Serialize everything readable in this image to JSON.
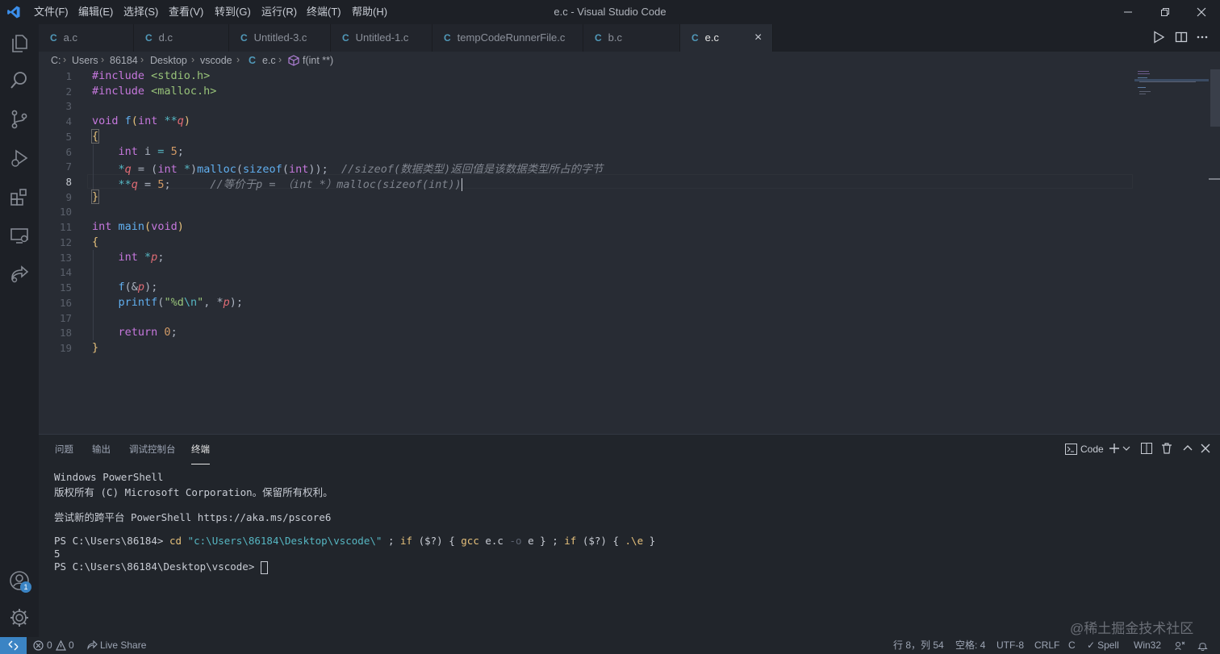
{
  "window": {
    "title": "e.c - Visual Studio Code"
  },
  "menu": [
    "文件(F)",
    "编辑(E)",
    "选择(S)",
    "查看(V)",
    "转到(G)",
    "运行(R)",
    "终端(T)",
    "帮助(H)"
  ],
  "tabs": [
    {
      "label": "a.c",
      "icon": "C"
    },
    {
      "label": "d.c",
      "icon": "C"
    },
    {
      "label": "Untitled-3.c",
      "icon": "C"
    },
    {
      "label": "Untitled-1.c",
      "icon": "C"
    },
    {
      "label": "tempCodeRunnerFile.c",
      "icon": "C"
    },
    {
      "label": "b.c",
      "icon": "C"
    },
    {
      "label": "e.c",
      "icon": "C",
      "close": "×"
    }
  ],
  "breadcrumb": {
    "items": [
      "C:",
      "Users",
      "86184",
      "Desktop",
      "vscode",
      "e.c",
      "f(int **)"
    ],
    "file_icon": "C"
  },
  "editor": {
    "line_numbers": [
      "1",
      "2",
      "3",
      "4",
      "5",
      "6",
      "7",
      "8",
      "9",
      "10",
      "11",
      "12",
      "13",
      "14",
      "15",
      "16",
      "17",
      "18",
      "19"
    ],
    "l1": {
      "a": "#include ",
      "b": "<stdio.h>"
    },
    "l2": {
      "a": "#include ",
      "b": "<malloc.h>"
    },
    "l4": {
      "kw": "void",
      "fn": "f",
      "p1": "(",
      "kw2": "int",
      "op": " **",
      "pm": "q",
      "p2": ")"
    },
    "l5": {
      "br": "{"
    },
    "l6": {
      "kw": "int",
      "t1": " i ",
      "op": "=",
      "num": " 5",
      "t2": ";"
    },
    "l7": {
      "op": "*",
      "pm": "q",
      "t1": " = (",
      "kw": "int",
      "op2": " *",
      "t2": ")",
      "fn": "malloc",
      "t3": "(",
      "fn2": "sizeof",
      "t4": "(",
      "kw2": "int",
      "t5": "));",
      "cm": "//sizeof(数据类型)返回值是该数据类型所占的字节"
    },
    "l8": {
      "op": "**",
      "pm": "q",
      "t1": " = ",
      "num": "5",
      "t2": ";",
      "cm": "//等价于p = （int *）malloc(sizeof(int))"
    },
    "l9": {
      "br": "}"
    },
    "l11": {
      "kw": "int",
      "fn": "main",
      "t1": "(",
      "kw2": "void",
      "t2": ")"
    },
    "l12": {
      "br": "{"
    },
    "l13": {
      "kw": "int",
      "op": " *",
      "pm": "p",
      "t1": ";"
    },
    "l15": {
      "fn": "f",
      "t1": "(&",
      "pm": "p",
      "t2": ");"
    },
    "l16": {
      "fn": "printf",
      "t1": "(",
      "str": "\"%d",
      "op": "\\n",
      "str2": "\"",
      "t2": ", *",
      "pm": "p",
      "t3": ");"
    },
    "l18": {
      "kw": "return",
      "num": " 0",
      "t1": ";"
    },
    "l19": {
      "br": "}"
    }
  },
  "panel": {
    "tabs": [
      "问题",
      "输出",
      "调试控制台",
      "终端"
    ],
    "terminal_name": "Code",
    "terminal": {
      "l1": "Windows PowerShell",
      "l2": "版权所有 (C) Microsoft Corporation。保留所有权利。",
      "l3": "尝试新的跨平台 PowerShell https://aka.ms/pscore6",
      "l4": {
        "prompt": "PS C:\\Users\\86184> ",
        "cd": "cd",
        "path": " \"c:\\Users\\86184\\Desktop\\vscode\\\"",
        "t1": " ; ",
        "if1": "if",
        "t2": " ($?) { ",
        "gcc": "gcc",
        "t3": " e.c ",
        "o": "-o",
        "t4": " e } ; ",
        "if2": "if",
        "t5": " ($?) { ",
        "run": ".\\e",
        "t6": " }"
      },
      "l5": "5",
      "l6": "PS C:\\Users\\86184\\Desktop\\vscode> "
    }
  },
  "statusbar": {
    "errors": "0",
    "warnings": "0",
    "liveshare": "Live Share",
    "position": "行 8，列 54",
    "spaces": "空格: 4",
    "encoding": "UTF-8",
    "eol": "CRLF",
    "language": "C",
    "spell": "Spell",
    "platform": "Win32"
  },
  "accounts_badge": "1",
  "watermark": "@稀土掘金技术社区",
  "colors": {
    "accent": "#3b84c4",
    "editor_bg": "#282c34",
    "panel_bg": "#21252b"
  }
}
